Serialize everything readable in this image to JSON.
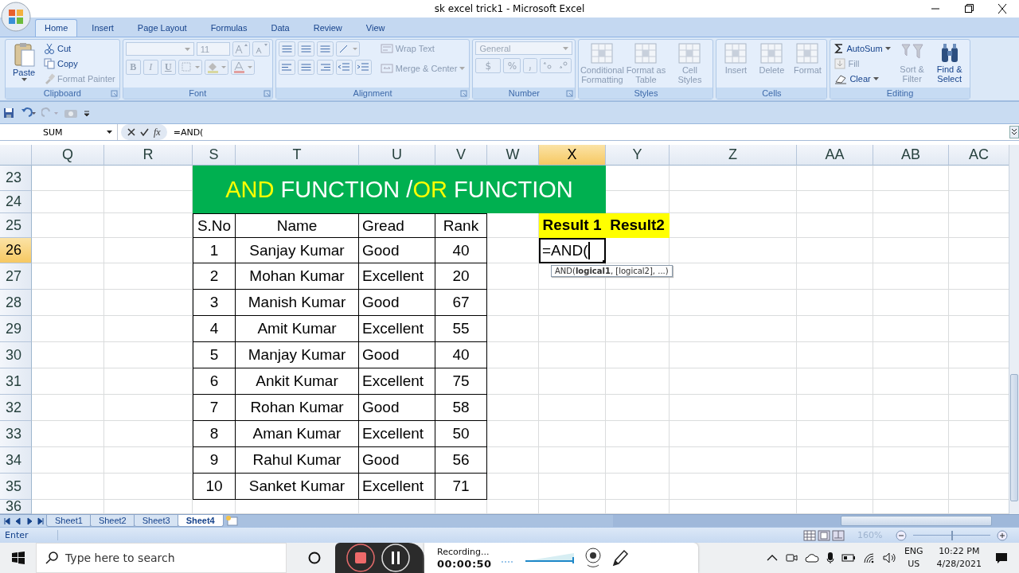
{
  "window": {
    "title": "sk excel trick1 - Microsoft Excel"
  },
  "ribbon": {
    "tabs": [
      {
        "label": "Home",
        "selected": true
      },
      {
        "label": "Insert",
        "selected": false
      },
      {
        "label": "Page Layout",
        "selected": false
      },
      {
        "label": "Formulas",
        "selected": false
      },
      {
        "label": "Data",
        "selected": false
      },
      {
        "label": "Review",
        "selected": false
      },
      {
        "label": "View",
        "selected": false
      }
    ],
    "groups": [
      {
        "kind": "clipboard",
        "label": "Clipboard",
        "buttons": [
          {
            "label": "Paste",
            "disabled": false
          },
          {
            "label": "Cut",
            "disabled": false
          },
          {
            "label": "Copy",
            "disabled": false
          },
          {
            "label": "Format Painter",
            "disabled": true
          }
        ]
      },
      {
        "kind": "font",
        "label": "Font",
        "font_size": "11",
        "style_buttons": [
          "B",
          "I",
          "U"
        ],
        "disabled": true
      },
      {
        "kind": "alignment",
        "label": "Alignment",
        "buttons": [
          {
            "label": "Wrap Text",
            "disabled": true
          },
          {
            "label": "Merge & Center",
            "disabled": true
          }
        ]
      },
      {
        "kind": "number",
        "label": "Number",
        "format": "General",
        "symbols": [
          "$",
          "%"
        ],
        "disabled": true
      },
      {
        "kind": "large",
        "label": "Styles",
        "buttons": [
          {
            "label": "Conditional Formatting",
            "disabled": true
          },
          {
            "label": "Format as Table",
            "disabled": true
          },
          {
            "label": "Cell Styles",
            "disabled": true
          }
        ]
      },
      {
        "kind": "large",
        "label": "Cells",
        "buttons": [
          {
            "label": "Insert",
            "disabled": true
          },
          {
            "label": "Delete",
            "disabled": true
          },
          {
            "label": "Format",
            "disabled": true
          }
        ]
      },
      {
        "kind": "editing",
        "label": "Editing",
        "buttons": [
          {
            "label": "AutoSum",
            "disabled": false
          },
          {
            "label": "Fill",
            "disabled": true
          },
          {
            "label": "Clear",
            "disabled": false
          },
          {
            "label": "Sort & Filter",
            "disabled": true
          },
          {
            "label": "Find & Select",
            "disabled": false
          }
        ]
      }
    ]
  },
  "formula_bar": {
    "name_box": "SUM",
    "function_label": "fx",
    "formula": "=AND("
  },
  "sheet": {
    "columns": [
      {
        "label": "Q",
        "selected": false
      },
      {
        "label": "R",
        "selected": false
      },
      {
        "label": "S",
        "selected": false
      },
      {
        "label": "T",
        "selected": false
      },
      {
        "label": "U",
        "selected": false
      },
      {
        "label": "V",
        "selected": false
      },
      {
        "label": "W",
        "selected": false
      },
      {
        "label": "X",
        "selected": true
      },
      {
        "label": "Y",
        "selected": false
      },
      {
        "label": "Z",
        "selected": false
      },
      {
        "label": "AA",
        "selected": false
      },
      {
        "label": "AB",
        "selected": false
      },
      {
        "label": "AC",
        "selected": false
      }
    ],
    "rows": [
      {
        "label": "23",
        "selected": false
      },
      {
        "label": "24",
        "selected": false
      },
      {
        "label": "25",
        "selected": false
      },
      {
        "label": "26",
        "selected": true
      },
      {
        "label": "27",
        "selected": false
      },
      {
        "label": "28",
        "selected": false
      },
      {
        "label": "29",
        "selected": false
      },
      {
        "label": "30",
        "selected": false
      },
      {
        "label": "31",
        "selected": false
      },
      {
        "label": "32",
        "selected": false
      },
      {
        "label": "33",
        "selected": false
      },
      {
        "label": "34",
        "selected": false
      },
      {
        "label": "35",
        "selected": false
      },
      {
        "label": "36",
        "selected": false
      }
    ],
    "banner": [
      {
        "text": "AND",
        "highlighted": true
      },
      {
        "text": " FUNCTION /",
        "highlighted": false
      },
      {
        "text": "OR",
        "highlighted": true
      },
      {
        "text": " FUNCTION",
        "highlighted": false
      }
    ],
    "table": {
      "columns": [
        "S.No",
        "Name",
        "Gread",
        "Rank"
      ],
      "rows": [
        [
          "1",
          "Sanjay Kumar",
          "Good",
          "40"
        ],
        [
          "2",
          "Mohan Kumar",
          "Excellent",
          "20"
        ],
        [
          "3",
          "Manish Kumar",
          "Good",
          "67"
        ],
        [
          "4",
          "Amit Kumar",
          "Excellent",
          "55"
        ],
        [
          "5",
          "Manjay Kumar",
          "Good",
          "40"
        ],
        [
          "6",
          "Ankit Kumar",
          "Excellent",
          "75"
        ],
        [
          "7",
          "Rohan Kumar",
          "Good",
          "58"
        ],
        [
          "8",
          "Aman Kumar",
          "Excellent",
          "50"
        ],
        [
          "9",
          "Rahul Kumar",
          "Good",
          "56"
        ],
        [
          "10",
          "Sanket Kumar",
          "Excellent",
          "71"
        ]
      ]
    },
    "result_headers": [
      "Result 1",
      "Result2"
    ],
    "active_cell": {
      "value": "=AND(",
      "tooltip": "AND(**logical1**, [logical2], ...)"
    }
  },
  "sheet_tabs": [
    {
      "label": "Sheet1",
      "selected": false
    },
    {
      "label": "Sheet2",
      "selected": false
    },
    {
      "label": "Sheet3",
      "selected": false
    },
    {
      "label": "Sheet4",
      "selected": true
    }
  ],
  "status_bar": {
    "mode": "Enter",
    "zoom": "160%",
    "zoom_slider": {
      "level": 0.5
    }
  },
  "taskbar": {
    "search_placeholder": "Type here to search",
    "recorder": {
      "status": "Recording...",
      "time": "00:00:50"
    },
    "language": [
      "ENG",
      "US"
    ],
    "clock": {
      "time": "10:22 PM",
      "date": "4/28/2021"
    }
  }
}
